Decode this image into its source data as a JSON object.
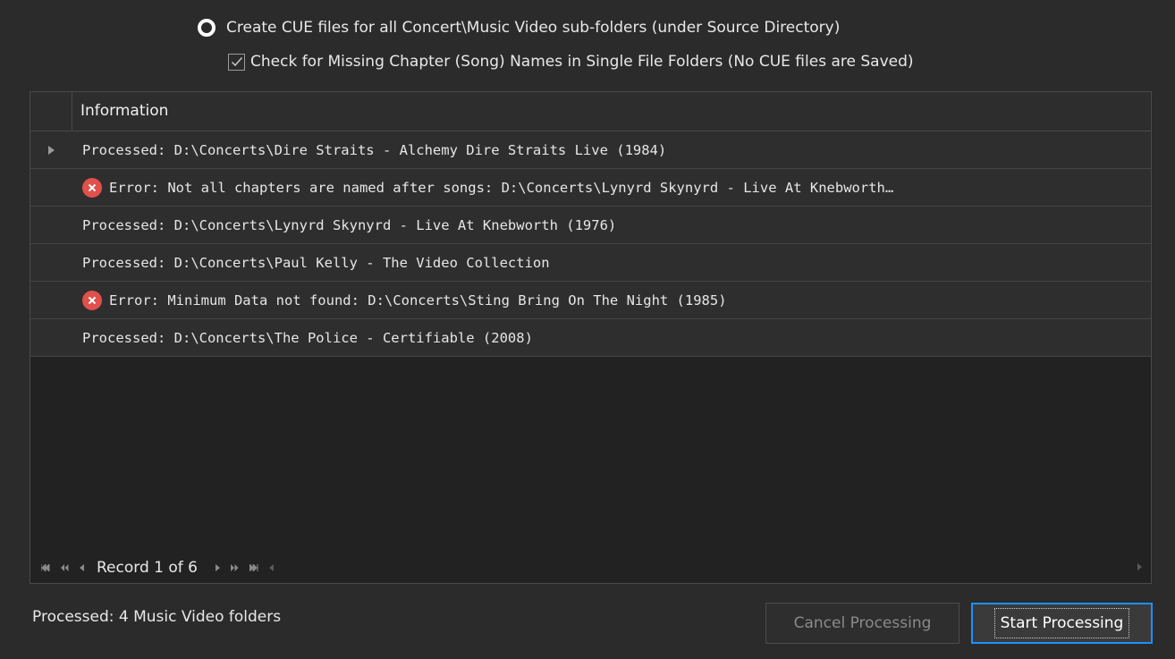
{
  "options": {
    "radio_label": "Create CUE files for all Concert\\Music Video sub-folders (under Source Directory)",
    "check_label": "Check for Missing Chapter (Song) Names in Single File Folders (No CUE files are Saved)"
  },
  "grid": {
    "column_header": "Information",
    "rows": [
      {
        "type": "info",
        "text": "Processed: D:\\Concerts\\Dire Straits - Alchemy Dire Straits Live (1984)"
      },
      {
        "type": "error",
        "text": "Error: Not all chapters are named after songs: D:\\Concerts\\Lynyrd Skynyrd - Live At Knebworth…"
      },
      {
        "type": "info",
        "text": "Processed: D:\\Concerts\\Lynyrd Skynyrd - Live At Knebworth (1976)"
      },
      {
        "type": "info",
        "text": "Processed: D:\\Concerts\\Paul Kelly - The Video Collection"
      },
      {
        "type": "error",
        "text": "Error: Minimum Data not found: D:\\Concerts\\Sting Bring On The Night (1985)"
      },
      {
        "type": "info",
        "text": "Processed: D:\\Concerts\\The Police - Certifiable (2008)"
      }
    ],
    "navigator_text": "Record 1 of 6"
  },
  "status": {
    "text": "Processed:  4 Music Video folders"
  },
  "buttons": {
    "cancel_label": "Cancel Processing",
    "start_label": "Start Processing"
  },
  "colors": {
    "background": "#2b2b2b",
    "error": "#e0504c",
    "accent": "#1e90ff"
  }
}
